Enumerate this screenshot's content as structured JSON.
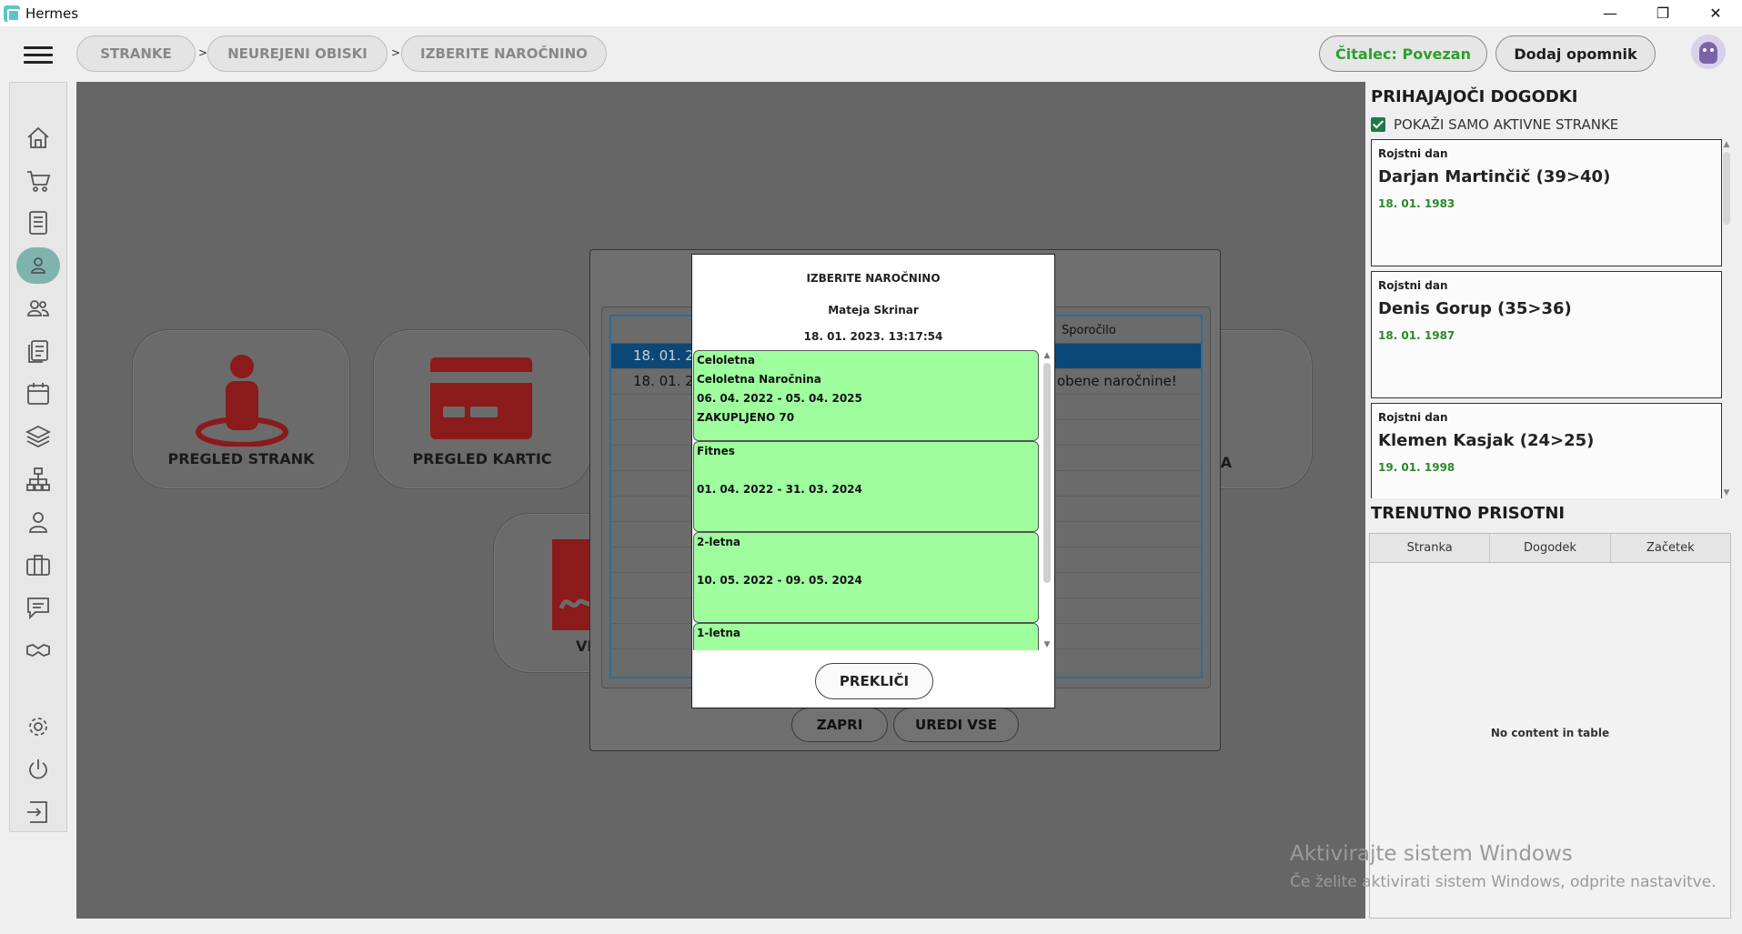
{
  "window": {
    "title": "Hermes",
    "controls": {
      "minimize": "—",
      "restore": "❐",
      "close": "✕"
    }
  },
  "breadcrumb": {
    "items": [
      "STRANKE",
      "NEUREJENI OBISKI",
      "IZBERITE NAROČNINO"
    ],
    "separator": ">"
  },
  "header": {
    "reader_status": "Čitalec: Povezan",
    "add_reminder": "Dodaj opomnik"
  },
  "sidebar": {
    "items": [
      {
        "icon": "home-icon"
      },
      {
        "icon": "cart-icon"
      },
      {
        "icon": "document-icon"
      },
      {
        "icon": "user-icon",
        "active": true
      },
      {
        "icon": "users-icon"
      },
      {
        "icon": "documents-icon"
      },
      {
        "icon": "calendar-icon"
      },
      {
        "icon": "layers-icon"
      },
      {
        "icon": "network-icon"
      },
      {
        "icon": "person-badge-icon"
      },
      {
        "icon": "briefcase-icon"
      },
      {
        "icon": "chat-icon"
      },
      {
        "icon": "handshake-icon"
      },
      {
        "icon": "gear-icon"
      },
      {
        "icon": "power-icon"
      },
      {
        "icon": "logout-icon"
      }
    ]
  },
  "tiles": {
    "clients_overview": "PREGLED STRANK",
    "cards_overview": "PREGLED KARTIC",
    "reader": "ČITALCA",
    "partial": "VE"
  },
  "visits_dialog": {
    "column_message": "Sporočilo",
    "rows": [
      {
        "date": "18. 01. 20",
        "message": "",
        "selected": true
      },
      {
        "date": "18. 01. 20",
        "message": "obene naročnine!",
        "selected": false
      }
    ],
    "close_button": "ZAPRI",
    "edit_all_button": "UREDI VSE"
  },
  "subscription_modal": {
    "title": "IZBERITE NAROČNINO",
    "client_name": "Mateja Skrinar",
    "timestamp": "18. 01. 2023. 13:17:54",
    "subscriptions": [
      {
        "name": "Celoletna",
        "detail": "Celoletna Naročnina",
        "period": "06. 04. 2022 - 05. 04. 2025",
        "extra": "ZAKUPLJENO 70"
      },
      {
        "name": "Fitnes",
        "detail": "",
        "period": "01. 04. 2022 - 31. 03. 2024",
        "extra": ""
      },
      {
        "name": "2-letna",
        "detail": "",
        "period": "10. 05. 2022 - 09. 05. 2024",
        "extra": ""
      },
      {
        "name": "1-letna",
        "detail": "",
        "period": "",
        "extra": ""
      }
    ],
    "cancel_button": "PREKLIČI"
  },
  "right_panel": {
    "upcoming_title": "PRIHAJAJOČI DOGODKI",
    "show_active_label": "POKAŽI SAMO AKTIVNE STRANKE",
    "events": [
      {
        "type": "Rojstni dan",
        "name": "Darjan Martinčič (39>40)",
        "date": "18. 01. 1983"
      },
      {
        "type": "Rojstni dan",
        "name": "Denis Gorup (35>36)",
        "date": "18. 01. 1987"
      },
      {
        "type": "Rojstni dan",
        "name": "Klemen Kasjak (24>25)",
        "date": "19. 01. 1998"
      }
    ],
    "present_title": "TRENUTNO PRISOTNI",
    "present_columns": [
      "Stranka",
      "Dogodek",
      "Začetek"
    ],
    "present_empty": "No content in table"
  },
  "watermark": {
    "line1": "Aktivirajte sistem Windows",
    "line2": "Če želite aktivirati sistem Windows, odprite nastavitve."
  },
  "colors": {
    "accent_green": "#2aa12a",
    "subscription_card": "#9efe9e",
    "selected_row": "#0c4877",
    "tile_icon_red": "#8b1a1a",
    "sidebar_active": "#7fb3ad"
  }
}
